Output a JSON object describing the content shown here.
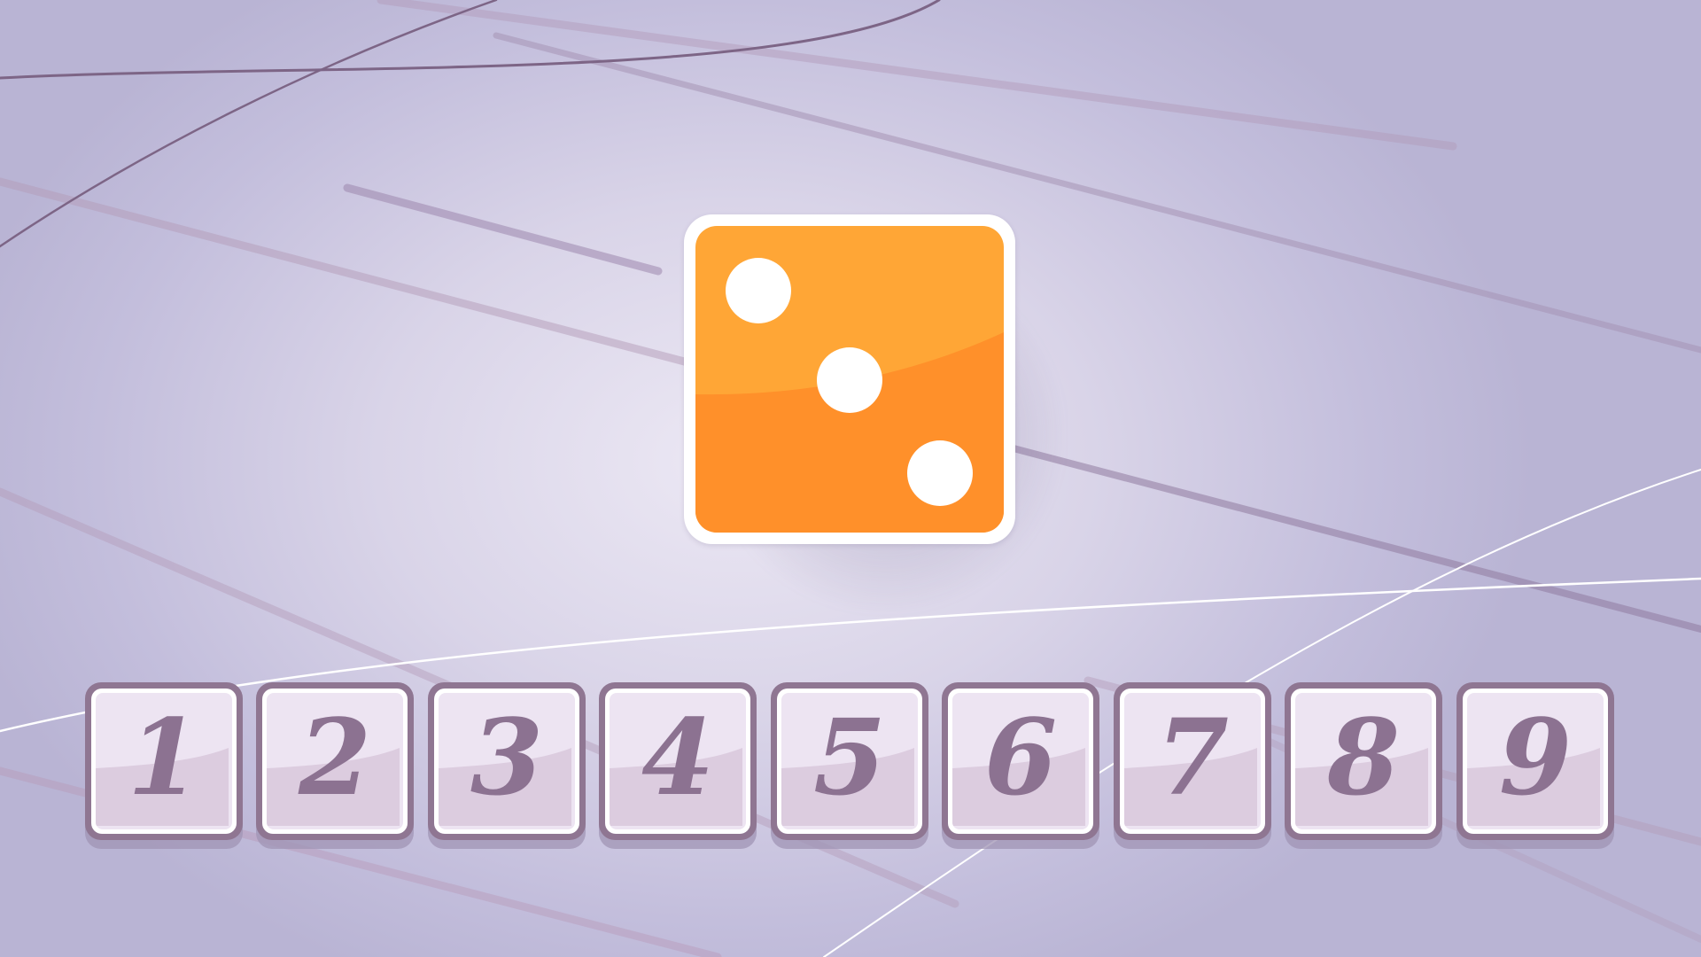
{
  "die": {
    "value": 3,
    "face_color": "#ffa636",
    "shade_color": "#ff902a",
    "pip_color": "#ffffff"
  },
  "number_buttons": [
    {
      "label": "1"
    },
    {
      "label": "2"
    },
    {
      "label": "3"
    },
    {
      "label": "4"
    },
    {
      "label": "5"
    },
    {
      "label": "6"
    },
    {
      "label": "7"
    },
    {
      "label": "8"
    },
    {
      "label": "9"
    }
  ],
  "colors": {
    "button_border": "#8f7692",
    "button_face": "#ede4f2",
    "digit": "#8c7291",
    "background": "#d9d4e8"
  }
}
